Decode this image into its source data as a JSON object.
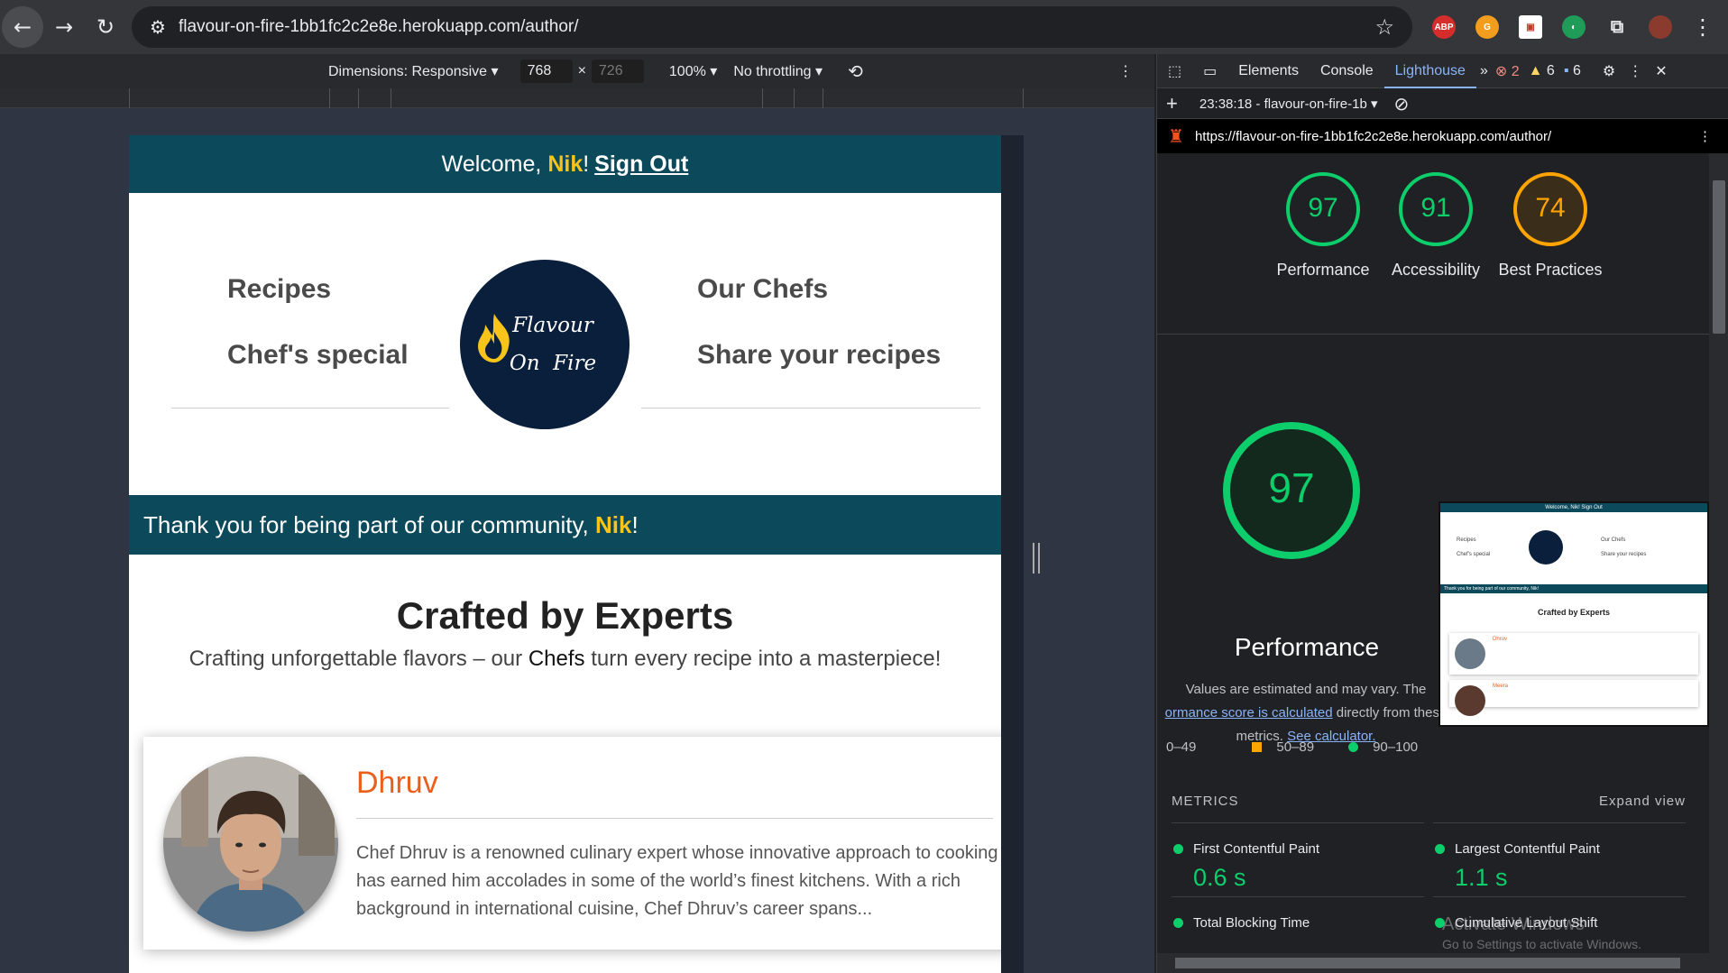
{
  "browser": {
    "back_icon": "←",
    "forward_icon": "→",
    "reload_icon": "↻",
    "url": "flavour-on-fire-1bb1fc2c2e8e.herokuapp.com/author/",
    "star_icon": "☆",
    "abp_label": "ABP",
    "menu_icon": "⋮"
  },
  "device_toolbar": {
    "dimensions_label": "Dimensions: Responsive ▾",
    "width": "768",
    "times": "×",
    "height": "726",
    "zoom": "100% ▾",
    "throttle": "No throttling ▾",
    "menu_icon": "⋮"
  },
  "site": {
    "welcome_prefix": "Welcome, ",
    "user_name": "Nik",
    "exclaim": "!",
    "sign_out": "Sign Out",
    "nav": {
      "recipes": "Recipes",
      "chefs_special": "Chef's special",
      "our_chefs": "Our Chefs",
      "share": "Share your recipes"
    },
    "logo_line1": "Flavour",
    "logo_line2": "On  Fire",
    "community_prefix": "Thank you for being part of our community, ",
    "community_name": "Nik",
    "community_suffix": "!",
    "crafted_title": "Crafted by Experts",
    "crafted_sub_prefix": "Crafting unforgettable flavors – our ",
    "crafted_sub_chefs": "Chefs",
    "crafted_sub_suffix": " turn every recipe into a masterpiece!",
    "chef": {
      "name": "Dhruv",
      "bio": "Chef Dhruv is a renowned culinary expert whose innovative approach to cooking has earned him accolades in some of the world’s finest kitchens. With a rich background in international cuisine, Chef Dhruv’s career spans..."
    }
  },
  "devtools": {
    "tabs": [
      "Elements",
      "Console",
      "Lighthouse"
    ],
    "more": "»",
    "errors": "2",
    "warnings": "6",
    "messages": "6",
    "close_icon": "✕",
    "report_label": "23:38:18 - flavour-on-fire-1b ▾",
    "add_icon": "+",
    "block_icon": "⊘",
    "report_url": "https://flavour-on-fire-1bb1fc2c2e8e.herokuapp.com/author/",
    "scores": [
      {
        "label": "Performance",
        "value": 97
      },
      {
        "label": "Accessibility",
        "value": 91
      },
      {
        "label": "Best Practices",
        "value": 74
      }
    ],
    "perf_big": {
      "value": "97",
      "label": "Performance"
    },
    "note_1": "Values are estimated and may vary. The",
    "note_link": "ormance score is calculated",
    "note_2": " directly from these",
    "note_3": "metrics. ",
    "note_calc": "See calculator.",
    "legend": [
      "0–49",
      "50–89",
      "90–100"
    ],
    "metrics_title": "METRICS",
    "expand": "Expand view",
    "metrics": [
      {
        "name": "First Contentful Paint",
        "value": "0.6 s"
      },
      {
        "name": "Largest Contentful Paint",
        "value": "1.1 s"
      },
      {
        "name": "Total Blocking Time",
        "value": ""
      },
      {
        "name": "Cumulative Layout Shift",
        "value": ""
      }
    ],
    "thumb": {
      "welcome": "Welcome, Nik! Sign Out",
      "recipes": "Recipes",
      "special": "Chef's special",
      "chefs": "Our Chefs",
      "share": "Share your recipes",
      "community": "Thank you for being part of our community, Nik!",
      "title": "Crafted by Experts",
      "chef1": "Dhruv",
      "chef2": "Meera"
    },
    "watermark_1": "Activate Windows",
    "watermark_2": "Go to Settings to activate Windows."
  },
  "colors": {
    "teal": "#0c4a5b",
    "gold": "#f8c41a",
    "orange": "#e8601c",
    "pass": "#0cce6b",
    "average": "#ffa400"
  }
}
